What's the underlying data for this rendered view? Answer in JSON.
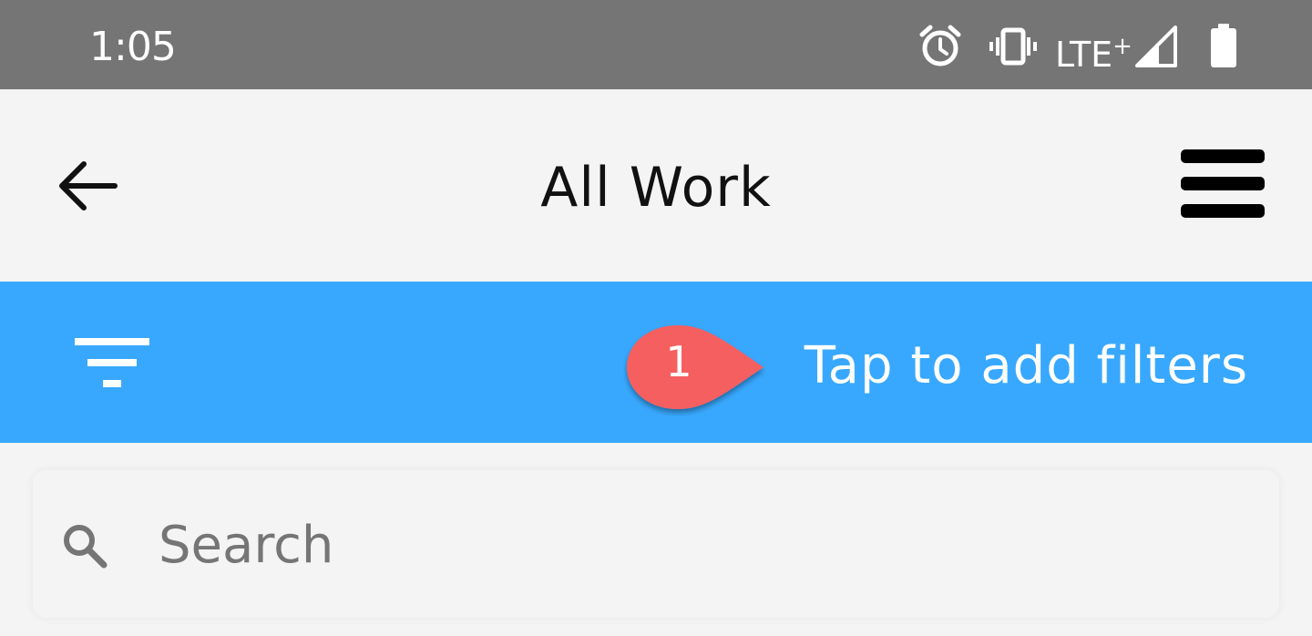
{
  "status_bar": {
    "time": "1:05",
    "network_label": "LTE",
    "network_plus": "+"
  },
  "header": {
    "title": "All Work"
  },
  "filter_bar": {
    "label": "Tap to add filters",
    "callout_number": "1",
    "background_color": "#38a8fe",
    "callout_color": "#f65f5e"
  },
  "search": {
    "placeholder": "Search"
  },
  "icons": {
    "back": "arrow-left-icon",
    "menu": "hamburger-menu-icon",
    "filter": "filter-lines-icon",
    "search": "magnifier-icon",
    "alarm": "alarm-clock-icon",
    "vibrate": "vibrate-icon",
    "signal": "cell-signal-icon",
    "battery": "battery-icon"
  }
}
